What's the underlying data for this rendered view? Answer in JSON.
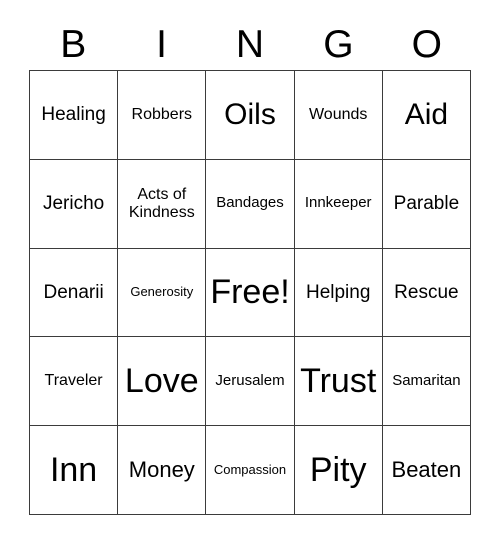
{
  "card": {
    "title": "BINGO",
    "header_letters": [
      "B",
      "I",
      "N",
      "G",
      "O"
    ],
    "columns": 5,
    "rows": 5,
    "free_space": "Free!",
    "border_color": "#3b3b3b",
    "background_color": "#ffffff",
    "text_color": "#000000",
    "cells": [
      [
        {
          "label": "Healing",
          "size": "l"
        },
        {
          "label": "Robbers",
          "size": "m"
        },
        {
          "label": "Oils",
          "size": "xxl"
        },
        {
          "label": "Wounds",
          "size": "m"
        },
        {
          "label": "Aid",
          "size": "xxl"
        }
      ],
      [
        {
          "label": "Jericho",
          "size": "l"
        },
        {
          "label": "Acts of\nKindness",
          "size": "m"
        },
        {
          "label": "Bandages",
          "size": "s"
        },
        {
          "label": "Innkeeper",
          "size": "s"
        },
        {
          "label": "Parable",
          "size": "l"
        }
      ],
      [
        {
          "label": "Denarii",
          "size": "l"
        },
        {
          "label": "Generosity",
          "size": "xs"
        },
        {
          "label": "Free!",
          "size": "huge"
        },
        {
          "label": "Helping",
          "size": "l"
        },
        {
          "label": "Rescue",
          "size": "l"
        }
      ],
      [
        {
          "label": "Traveler",
          "size": "m"
        },
        {
          "label": "Love",
          "size": "huge"
        },
        {
          "label": "Jerusalem",
          "size": "s"
        },
        {
          "label": "Trust",
          "size": "huge"
        },
        {
          "label": "Samaritan",
          "size": "s"
        }
      ],
      [
        {
          "label": "Inn",
          "size": "huge"
        },
        {
          "label": "Money",
          "size": "xl"
        },
        {
          "label": "Compassion",
          "size": "xs"
        },
        {
          "label": "Pity",
          "size": "huge"
        },
        {
          "label": "Beaten",
          "size": "xl"
        }
      ]
    ]
  }
}
